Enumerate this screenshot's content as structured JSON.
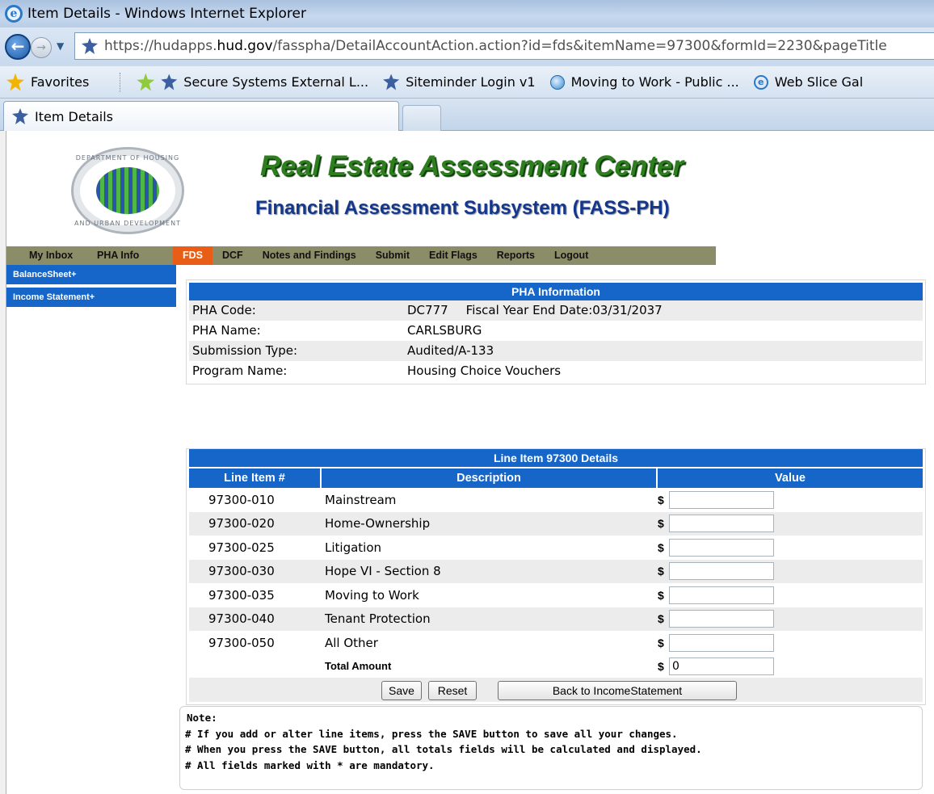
{
  "browser": {
    "window_title": "Item Details - Windows Internet Explorer",
    "url_prefix": "https://hudapps.",
    "url_domain": "hud.gov",
    "url_rest": "/fasspha/DetailAccountAction.action?id=fds&itemName=97300&formId=2230&pageTitle",
    "favorites_label": "Favorites",
    "favorites_links": [
      "Secure Systems External L...",
      "Siteminder Login v1",
      "Moving to Work - Public ...",
      "Web Slice Gal"
    ],
    "tab_label": "Item Details"
  },
  "header": {
    "seal_top_text": "DEPARTMENT OF HOUSING",
    "seal_bottom_text": "AND URBAN DEVELOPMENT",
    "title": "Real Estate Assessment Center",
    "subtitle": "Financial Assessment Subsystem (FASS-PH)"
  },
  "menu": {
    "items": [
      "My Inbox",
      "PHA Info",
      "FDS",
      "DCF",
      "Notes and Findings",
      "Submit",
      "Edit Flags",
      "Reports",
      "Logout"
    ],
    "active": "FDS"
  },
  "sidebar": {
    "items": [
      "BalanceSheet+",
      "Income Statement+"
    ]
  },
  "pha_info": {
    "heading": "PHA Information",
    "rows": [
      {
        "label": "PHA Code:",
        "value": "DC777",
        "extra": "Fiscal Year End Date:03/31/2037"
      },
      {
        "label": "PHA Name:",
        "value": "CARLSBURG"
      },
      {
        "label": "Submission Type:",
        "value": "Audited/A-133"
      },
      {
        "label": "Program Name:",
        "value": "Housing Choice Vouchers"
      }
    ]
  },
  "line_items": {
    "heading": "Line Item 97300 Details",
    "columns": [
      "Line Item #",
      "Description",
      "Value"
    ],
    "currency": "$",
    "rows": [
      {
        "code": "97300-010",
        "desc": "Mainstream",
        "value": ""
      },
      {
        "code": "97300-020",
        "desc": "Home-Ownership",
        "value": ""
      },
      {
        "code": "97300-025",
        "desc": "Litigation",
        "value": ""
      },
      {
        "code": "97300-030",
        "desc": "Hope VI - Section 8",
        "value": ""
      },
      {
        "code": "97300-035",
        "desc": "Moving to Work",
        "value": ""
      },
      {
        "code": "97300-040",
        "desc": "Tenant Protection",
        "value": ""
      },
      {
        "code": "97300-050",
        "desc": "All Other",
        "value": ""
      }
    ],
    "total_label": "Total Amount",
    "total_value": "0",
    "buttons": {
      "save": "Save",
      "reset": "Reset",
      "back": "Back to IncomeStatement"
    }
  },
  "note": {
    "title": "Note:",
    "lines": [
      "# If you add or alter line items, press the SAVE button to save all your changes.",
      "# When you press the SAVE button, all totals fields will be calculated and displayed.",
      "# All fields marked with * are mandatory."
    ]
  }
}
